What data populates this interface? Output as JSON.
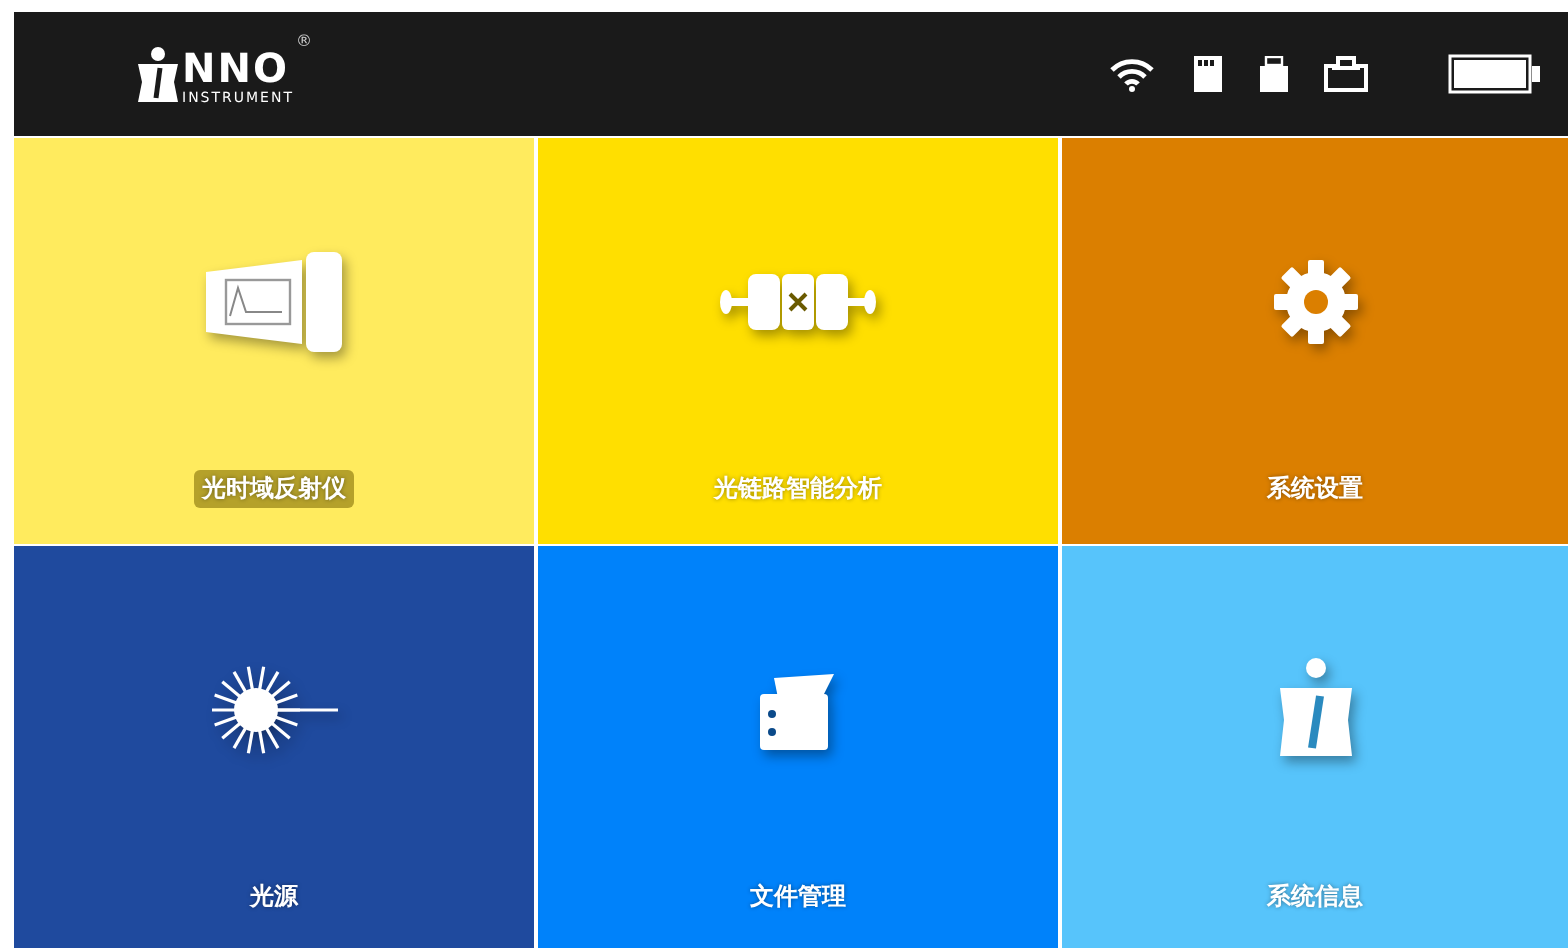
{
  "header": {
    "logo": {
      "mark": "NNO",
      "subtitle": "INSTRUMENT",
      "registered": "®"
    }
  },
  "tiles": [
    {
      "label": "光时域反射仪",
      "kind": "otdr",
      "color": "#ffeb5e"
    },
    {
      "label": "光链路智能分析",
      "kind": "link",
      "color": "#ffdf00"
    },
    {
      "label": "系统设置",
      "kind": "settings",
      "color": "#db7f00"
    },
    {
      "label": "光源",
      "kind": "laser",
      "color": "#1f4a9e"
    },
    {
      "label": "文件管理",
      "kind": "files",
      "color": "#0082fa"
    },
    {
      "label": "系统信息",
      "kind": "info",
      "color": "#57c4fb"
    }
  ]
}
